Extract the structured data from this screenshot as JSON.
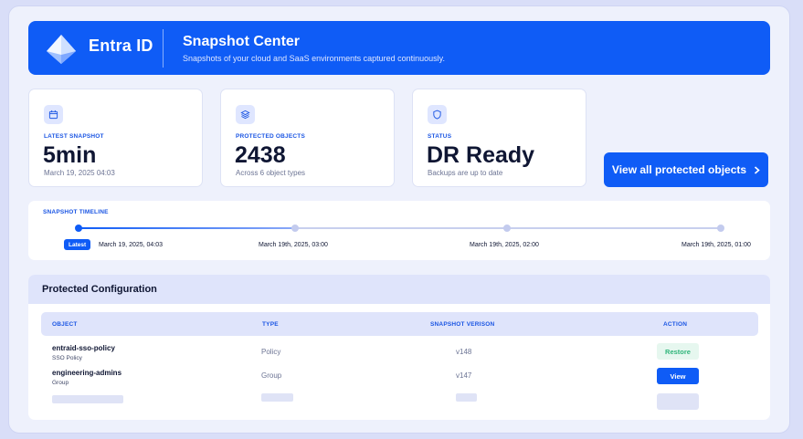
{
  "brand": {
    "name": "Entra ID"
  },
  "header": {
    "title": "Snapshot Center",
    "subtitle": "Snapshots of your cloud and SaaS environments captured continuously."
  },
  "stats": [
    {
      "icon": "calendar-icon",
      "label": "LATEST SNAPSHOT",
      "value": "5min",
      "note": "March 19, 2025 04:03"
    },
    {
      "icon": "layers-icon",
      "label": "PROTECTED OBJECTS",
      "value": "2438",
      "note": "Across 6 object types"
    },
    {
      "icon": "shield-icon",
      "label": "STATUS",
      "value": "DR Ready",
      "note": "Backups are up to date"
    }
  ],
  "cta": {
    "label": "View all protected objects",
    "icon": "chevron-right-icon"
  },
  "timeline": {
    "title": "SNAPSHOT TIMELINE",
    "latest_badge": "Latest",
    "points": [
      "March 19, 2025, 04:03",
      "March 19th, 2025, 03:00",
      "March 19th, 2025, 02:00",
      "March 19th, 2025, 01:00"
    ]
  },
  "config": {
    "title": "Protected Configuration",
    "columns": [
      "OBJECT",
      "TYPE",
      "SNAPSHOT VERISON",
      "ACTION"
    ],
    "rows": [
      {
        "name": "entraid-sso-policy",
        "sub": "SSO Policy",
        "type": "Policy",
        "version": "v148",
        "action": "Restore"
      },
      {
        "name": "engineering-admins",
        "sub": "Group",
        "type": "Group",
        "version": "v147",
        "action": "View"
      }
    ]
  },
  "colors": {
    "accent": "#0f5cf6",
    "success": "#2fb57a",
    "background": "#eef1fc"
  }
}
